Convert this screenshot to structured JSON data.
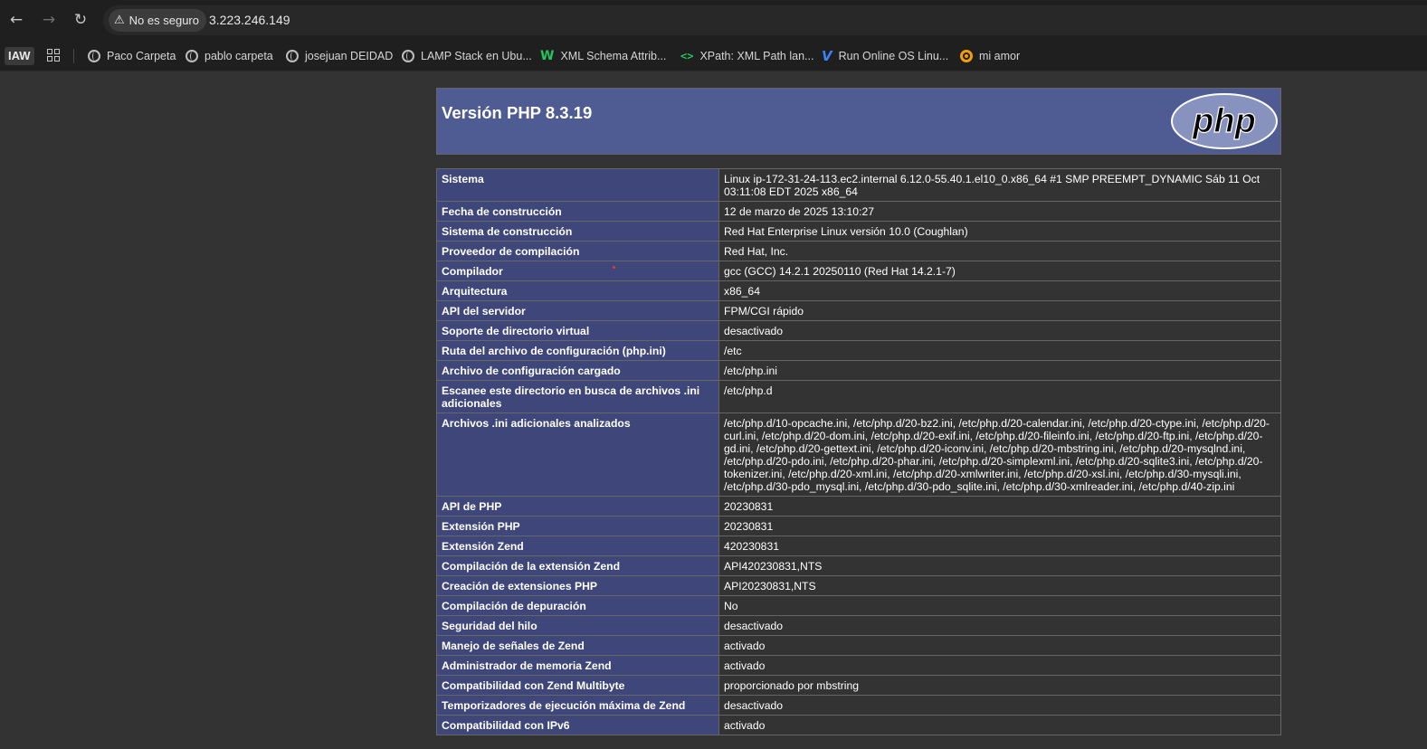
{
  "browser": {
    "security_label": "No es seguro",
    "url": "3.223.246.149",
    "icons": {
      "back": "arrow-left-icon",
      "forward": "arrow-right-icon",
      "reload": "reload-icon",
      "warning": "warning-triangle-icon"
    }
  },
  "bookmarks": {
    "folder_label": "IAW",
    "items": [
      {
        "label": "Paco Carpeta",
        "icon": "globe-icon"
      },
      {
        "label": "pablo carpeta",
        "icon": "globe-icon"
      },
      {
        "label": "josejuan DEIDAD",
        "icon": "globe-icon"
      },
      {
        "label": "LAMP Stack en Ubu...",
        "icon": "globe-icon"
      },
      {
        "label": "XML Schema Attrib...",
        "icon": "w3schools-icon"
      },
      {
        "label": "XPath: XML Path lan...",
        "icon": "code-icon"
      },
      {
        "label": "Run Online OS Linu...",
        "icon": "v-logo-icon"
      },
      {
        "label": "mi amor",
        "icon": "ring-icon"
      }
    ]
  },
  "phpinfo": {
    "title": "Versión PHP 8.3.19",
    "logo_text": "php",
    "rows": [
      {
        "key": "Sistema",
        "value": "Linux ip-172-31-24-113.ec2.internal 6.12.0-55.40.1.el10_0.x86_64 #1 SMP PREEMPT_DYNAMIC Sáb 11 Oct 03:11:08 EDT 2025 x86_64"
      },
      {
        "key": "Fecha de construcción",
        "value": "12 de marzo de 2025 13:10:27"
      },
      {
        "key": "Sistema de construcción",
        "value": "Red Hat Enterprise Linux versión 10.0 (Coughlan)"
      },
      {
        "key": "Proveedor de compilación",
        "value": "Red Hat, Inc."
      },
      {
        "key": "Compilador",
        "value": "gcc (GCC) 14.2.1 20250110 (Red Hat 14.2.1-7)"
      },
      {
        "key": "Arquitectura",
        "value": "x86_64"
      },
      {
        "key": "API del servidor",
        "value": "FPM/CGI rápido"
      },
      {
        "key": "Soporte de directorio virtual",
        "value": "desactivado"
      },
      {
        "key": "Ruta del archivo de configuración (php.ini)",
        "value": "/etc"
      },
      {
        "key": "Archivo de configuración cargado",
        "value": "/etc/php.ini"
      },
      {
        "key": "Escanee este directorio en busca de archivos .ini adicionales",
        "value": "/etc/php.d"
      },
      {
        "key": "Archivos .ini adicionales analizados",
        "value": "/etc/php.d/10-opcache.ini, /etc/php.d/20-bz2.ini, /etc/php.d/20-calendar.ini, /etc/php.d/20-ctype.ini, /etc/php.d/20-curl.ini, /etc/php.d/20-dom.ini, /etc/php.d/20-exif.ini, /etc/php.d/20-fileinfo.ini, /etc/php.d/20-ftp.ini, /etc/php.d/20-gd.ini, /etc/php.d/20-gettext.ini, /etc/php.d/20-iconv.ini, /etc/php.d/20-mbstring.ini, /etc/php.d/20-mysqlnd.ini, /etc/php.d/20-pdo.ini, /etc/php.d/20-phar.ini, /etc/php.d/20-simplexml.ini, /etc/php.d/20-sqlite3.ini, /etc/php.d/20-tokenizer.ini, /etc/php.d/20-xml.ini, /etc/php.d/20-xmlwriter.ini, /etc/php.d/20-xsl.ini, /etc/php.d/30-mysqli.ini, /etc/php.d/30-pdo_mysql.ini, /etc/php.d/30-pdo_sqlite.ini, /etc/php.d/30-xmlreader.ini, /etc/php.d/40-zip.ini"
      },
      {
        "key": "API de PHP",
        "value": "20230831"
      },
      {
        "key": "Extensión PHP",
        "value": "20230831"
      },
      {
        "key": "Extensión Zend",
        "value": "420230831"
      },
      {
        "key": "Compilación de la extensión Zend",
        "value": "API420230831,NTS"
      },
      {
        "key": "Creación de extensiones PHP",
        "value": "API20230831,NTS"
      },
      {
        "key": "Compilación de depuración",
        "value": "No"
      },
      {
        "key": "Seguridad del hilo",
        "value": "desactivado"
      },
      {
        "key": "Manejo de señales de Zend",
        "value": "activado"
      },
      {
        "key": "Administrador de memoria Zend",
        "value": "activado"
      },
      {
        "key": "Compatibilidad con Zend Multibyte",
        "value": "proporcionado por mbstring"
      },
      {
        "key": "Temporizadores de ejecución máxima de Zend",
        "value": "desactivado"
      },
      {
        "key": "Compatibilidad con IPv6",
        "value": "activado"
      }
    ]
  }
}
